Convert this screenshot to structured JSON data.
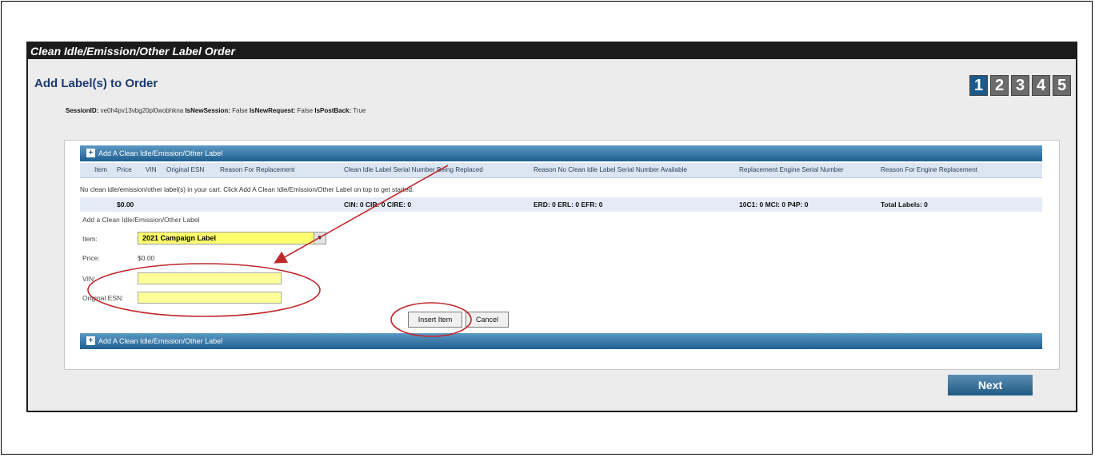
{
  "window": {
    "title": "Clean Idle/Emission/Other Label Order"
  },
  "page": {
    "title": "Add Label(s) to Order"
  },
  "steps": [
    "1",
    "2",
    "3",
    "4",
    "5"
  ],
  "session": {
    "id_label": "SessionID:",
    "id_value": "ve0h4pv13vbg20pl0wobhkna",
    "new_session_label": "IsNewSession:",
    "new_session_value": "False",
    "new_request_label": "IsNewRequest:",
    "new_request_value": "False",
    "postback_label": "IsPostBack:",
    "postback_value": "True"
  },
  "grid": {
    "add_label": "Add A Clean Idle/Emission/Other Label",
    "columns": [
      "Item",
      "Price",
      "VIN",
      "Original ESN",
      "Reason For Replacement",
      "Clean Idle Label Serial Number Being Replaced",
      "Reason No Clean Idle Label Serial Number Available",
      "Replacement Engine Serial Number",
      "Reason For Engine Replacement"
    ],
    "empty_message": "No clean idle/emission/other label(s) in your cart. Click Add A Clean Idle/Emission/Other Label on top to get started.",
    "totals": {
      "price": "$0.00",
      "cin": "CIN: 0  CIR: 0  CIRE: 0",
      "erd": "ERD: 0  ERL: 0  EFR: 0",
      "c10": "10C1: 0  MCI: 0  P4P: 0",
      "total": "Total Labels: 0"
    }
  },
  "form": {
    "title": "Add a Clean Idle/Emission/Other Label",
    "item_label": "Item:",
    "item_value": "2021 Campaign Label",
    "price_label": "Price:",
    "price_value": "$0.00",
    "vin_label": "VIN:",
    "esn_label": "Original ESN:",
    "insert_label": "Insert Item",
    "cancel_label": "Cancel"
  },
  "next_label": "Next",
  "colors": {
    "accent": "#1e5f91",
    "annotation": "#c0282b",
    "highlight": "#ffff70"
  }
}
